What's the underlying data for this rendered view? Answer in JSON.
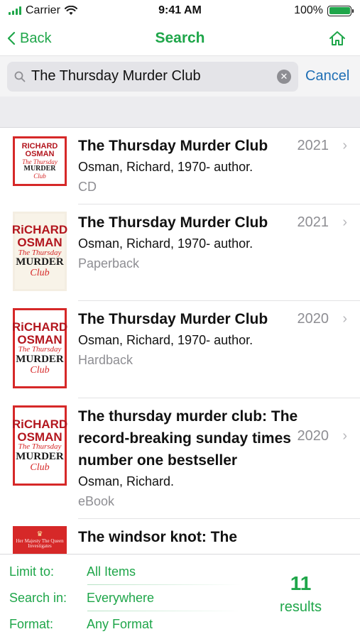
{
  "status_bar": {
    "carrier": "Carrier",
    "time": "9:41 AM",
    "battery": "100%",
    "battery_level": 1.0,
    "signal_bars": 4
  },
  "nav": {
    "back_label": "Back",
    "title": "Search"
  },
  "search": {
    "query": "The Thursday Murder Club",
    "cancel_label": "Cancel"
  },
  "results": [
    {
      "title": "The Thursday Murder Club",
      "author": "Osman, Richard, 1970- author.",
      "format": "CD",
      "year": "2021",
      "cover": {
        "author": "RICHARD OSMAN",
        "the": "The Thursday",
        "murder": "MURDER",
        "club": "Club"
      }
    },
    {
      "title": "The Thursday Murder Club",
      "author": "Osman, Richard, 1970- author.",
      "format": "Paperback",
      "year": "2021",
      "cover": {
        "author": "RiCHARD OSMAN",
        "the": "The Thursday",
        "murder": "MURDER",
        "club": "Club"
      }
    },
    {
      "title": "The Thursday Murder Club",
      "author": "Osman, Richard, 1970- author.",
      "format": "Hardback",
      "year": "2020",
      "cover": {
        "author": "RiCHARD OSMAN",
        "the": "The Thursday",
        "murder": "MURDER",
        "club": "Club"
      }
    },
    {
      "title": "The thursday murder club: The record-breaking sunday times number one bestseller",
      "author": "Osman, Richard.",
      "format": "eBook",
      "year": "2020",
      "cover": {
        "author": "RiCHARD OSMAN",
        "the": "The Thursday",
        "murder": "MURDER",
        "club": "Club"
      }
    },
    {
      "title": "The windsor knot: The",
      "cover": {
        "crown": "♛",
        "tag": "Her Majesty The Queen Investigates"
      }
    }
  ],
  "footer": {
    "filters": [
      {
        "label": "Limit to:",
        "value": "All Items"
      },
      {
        "label": "Search in:",
        "value": "Everywhere"
      },
      {
        "label": "Format:",
        "value": "Any Format"
      }
    ],
    "count": "11",
    "count_label": "results"
  },
  "colors": {
    "accent": "#1fa64a",
    "link_blue": "#1f6fb5",
    "cover_red": "#d62828",
    "secondary_text": "#8e8e93"
  }
}
